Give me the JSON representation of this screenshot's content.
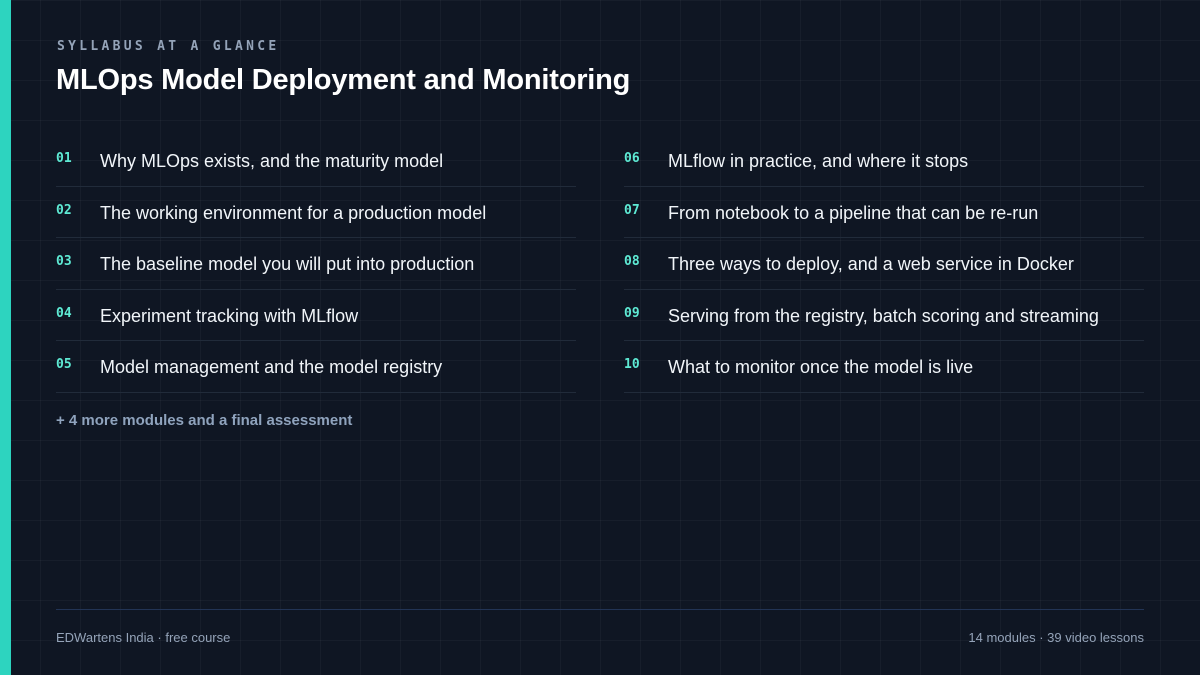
{
  "colors": {
    "accent": "#2dd4bf",
    "background": "#0f1623",
    "number": "#5eead4"
  },
  "header": {
    "eyebrow": "SYLLABUS AT A GLANCE",
    "title": "MLOps Model Deployment and Monitoring"
  },
  "modules": {
    "left": [
      {
        "num": "01",
        "title": "Why MLOps exists, and the maturity model"
      },
      {
        "num": "02",
        "title": "The working environment for a production model"
      },
      {
        "num": "03",
        "title": "The baseline model you will put into production"
      },
      {
        "num": "04",
        "title": "Experiment tracking with MLflow"
      },
      {
        "num": "05",
        "title": "Model management and the model registry"
      }
    ],
    "right": [
      {
        "num": "06",
        "title": "MLflow in practice, and where it stops"
      },
      {
        "num": "07",
        "title": "From notebook to a pipeline that can be re-run"
      },
      {
        "num": "08",
        "title": "Three ways to deploy, and a web service in Docker"
      },
      {
        "num": "09",
        "title": "Serving from the registry, batch scoring and streaming"
      },
      {
        "num": "10",
        "title": "What to monitor once the model is live"
      }
    ]
  },
  "more_text": "+ 4 more modules and a final assessment",
  "footer": {
    "left": "EDWartens India · free course",
    "right": "14 modules · 39 video lessons"
  }
}
